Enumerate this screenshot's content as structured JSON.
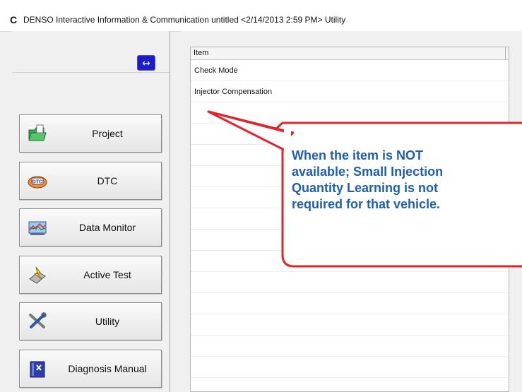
{
  "window": {
    "logo_letter": "C",
    "title": "DENSO Interactive Information & Communication untitled <2/14/2013 2:59 PM> Utility"
  },
  "sidebar": {
    "swap_symbol": "↔",
    "items": [
      {
        "label": "Project",
        "icon": "project-folder-icon"
      },
      {
        "label": "DTC",
        "icon": "dtc-icon"
      },
      {
        "label": "Data Monitor",
        "icon": "data-monitor-icon"
      },
      {
        "label": "Active Test",
        "icon": "active-test-icon"
      },
      {
        "label": "Utility",
        "icon": "utility-tools-icon"
      },
      {
        "label": "Diagnosis Manual",
        "icon": "diagnosis-manual-icon"
      }
    ]
  },
  "list": {
    "header": "Item",
    "rows": [
      "Check Mode",
      "Injector Compensation"
    ]
  },
  "callout": {
    "lines": [
      "When the item is NOT",
      "available; Small Injection",
      "Quantity Learning is not",
      "required for that vehicle."
    ]
  },
  "colors": {
    "callout_border": "#e0262b",
    "callout_text": "#1f5fb0",
    "swap_button": "#1a1ad8"
  }
}
